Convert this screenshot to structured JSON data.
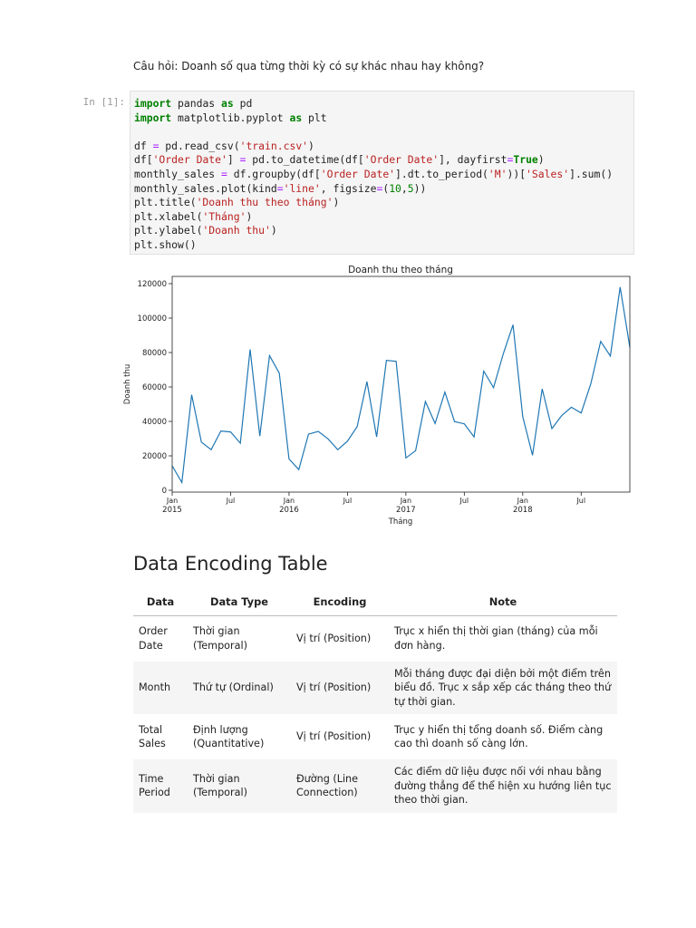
{
  "question": "Câu hỏi: Doanh số qua từng thời kỳ có sự khác nhau hay không?",
  "cell": {
    "prompt": "In [1]:"
  },
  "code": {
    "l1": [
      {
        "t": "import",
        "c": "kw"
      },
      {
        "t": " pandas "
      },
      {
        "t": "as",
        "c": "kw"
      },
      {
        "t": " pd"
      }
    ],
    "l2": [
      {
        "t": "import",
        "c": "kw"
      },
      {
        "t": " matplotlib.pyplot "
      },
      {
        "t": "as",
        "c": "kw"
      },
      {
        "t": " plt"
      }
    ],
    "l3": [],
    "l4": [
      {
        "t": "df "
      },
      {
        "t": "=",
        "c": "op"
      },
      {
        "t": " pd.read_csv("
      },
      {
        "t": "'train.csv'",
        "c": "st"
      },
      {
        "t": ")"
      }
    ],
    "l5": [
      {
        "t": "df["
      },
      {
        "t": "'Order Date'",
        "c": "st"
      },
      {
        "t": "] "
      },
      {
        "t": "=",
        "c": "op"
      },
      {
        "t": " pd.to_datetime(df["
      },
      {
        "t": "'Order Date'",
        "c": "st"
      },
      {
        "t": "], dayfirst"
      },
      {
        "t": "=",
        "c": "op"
      },
      {
        "t": "True",
        "c": "kw"
      },
      {
        "t": ")"
      }
    ],
    "l6": [
      {
        "t": "monthly_sales "
      },
      {
        "t": "=",
        "c": "op"
      },
      {
        "t": " df.groupby(df["
      },
      {
        "t": "'Order Date'",
        "c": "st"
      },
      {
        "t": "].dt.to_period("
      },
      {
        "t": "'M'",
        "c": "st"
      },
      {
        "t": "))["
      },
      {
        "t": "'Sales'",
        "c": "st"
      },
      {
        "t": "].sum()"
      }
    ],
    "l7": [
      {
        "t": "monthly_sales.plot(kind"
      },
      {
        "t": "=",
        "c": "op"
      },
      {
        "t": "'line'",
        "c": "st"
      },
      {
        "t": ", figsize"
      },
      {
        "t": "=",
        "c": "op"
      },
      {
        "t": "("
      },
      {
        "t": "10",
        "c": "nm"
      },
      {
        "t": ","
      },
      {
        "t": "5",
        "c": "nm"
      },
      {
        "t": "))"
      }
    ],
    "l8": [
      {
        "t": "plt.title("
      },
      {
        "t": "'Doanh thu theo tháng'",
        "c": "st"
      },
      {
        "t": ")"
      }
    ],
    "l9": [
      {
        "t": "plt.xlabel("
      },
      {
        "t": "'Tháng'",
        "c": "st"
      },
      {
        "t": ")"
      }
    ],
    "l10": [
      {
        "t": "plt.ylabel("
      },
      {
        "t": "'Doanh thu'",
        "c": "st"
      },
      {
        "t": ")"
      }
    ],
    "l11": [
      {
        "t": "plt.show()"
      }
    ]
  },
  "chart_data": {
    "type": "line",
    "title": "Doanh thu theo tháng",
    "xlabel": "Tháng",
    "ylabel": "Doanh thu",
    "ylim": [
      0,
      120000
    ],
    "yticks": [
      0,
      20000,
      40000,
      60000,
      80000,
      100000,
      120000
    ],
    "xticks": [
      {
        "month": 0,
        "label": "Jan",
        "year": "2015"
      },
      {
        "month": 6,
        "label": "Jul",
        "year": ""
      },
      {
        "month": 12,
        "label": "Jan",
        "year": "2016"
      },
      {
        "month": 18,
        "label": "Jul",
        "year": ""
      },
      {
        "month": 24,
        "label": "Jan",
        "year": "2017"
      },
      {
        "month": 30,
        "label": "Jul",
        "year": ""
      },
      {
        "month": 36,
        "label": "Jan",
        "year": "2018"
      },
      {
        "month": 42,
        "label": "Jul",
        "year": ""
      }
    ],
    "x": [
      "2015-01",
      "2015-02",
      "2015-03",
      "2015-04",
      "2015-05",
      "2015-06",
      "2015-07",
      "2015-08",
      "2015-09",
      "2015-10",
      "2015-11",
      "2015-12",
      "2016-01",
      "2016-02",
      "2016-03",
      "2016-04",
      "2016-05",
      "2016-06",
      "2016-07",
      "2016-08",
      "2016-09",
      "2016-10",
      "2016-11",
      "2016-12",
      "2017-01",
      "2017-02",
      "2017-03",
      "2017-04",
      "2017-05",
      "2017-06",
      "2017-07",
      "2017-08",
      "2017-09",
      "2017-10",
      "2017-11",
      "2017-12",
      "2018-01",
      "2018-02",
      "2018-03",
      "2018-04",
      "2018-05",
      "2018-06",
      "2018-07",
      "2018-08",
      "2018-09",
      "2018-10",
      "2018-11",
      "2018-12"
    ],
    "series": [
      {
        "values": [
          14200,
          4500,
          55500,
          28000,
          23600,
          34400,
          33900,
          27300,
          81800,
          31500,
          78200,
          68000,
          18200,
          12000,
          32600,
          34200,
          29900,
          23600,
          28500,
          37000,
          63100,
          31000,
          75400,
          74900,
          18800,
          23000,
          51600,
          38800,
          57000,
          39900,
          38600,
          31000,
          69200,
          59600,
          79200,
          96100,
          42800,
          20300,
          58900,
          35800,
          43400,
          48200,
          44900,
          62000,
          86500,
          78000,
          118000,
          83000
        ],
        "color": "#1f77b4"
      }
    ]
  },
  "encoding": {
    "heading": "Data Encoding Table",
    "headers": [
      "Data",
      "Data Type",
      "Encoding",
      "Note"
    ],
    "rows": [
      [
        "Order Date",
        "Thời gian (Temporal)",
        "Vị trí (Position)",
        "Trục x hiển thị thời gian (tháng) của mỗi đơn hàng."
      ],
      [
        "Month",
        "Thứ tự (Ordinal)",
        "Vị trí (Position)",
        "Mỗi tháng được đại diện bởi một điểm trên biểu đồ. Trục x sắp xếp các tháng theo thứ tự thời gian."
      ],
      [
        "Total Sales",
        "Định lượng (Quantitative)",
        "Vị trí (Position)",
        "Trục y hiển thị tổng doanh số. Điểm càng cao thì doanh số càng lớn."
      ],
      [
        "Time Period",
        "Thời gian (Temporal)",
        "Đường (Line Connection)",
        "Các điểm dữ liệu được nối với nhau bằng đường thẳng để thể hiện xu hướng liên tục theo thời gian."
      ]
    ]
  }
}
